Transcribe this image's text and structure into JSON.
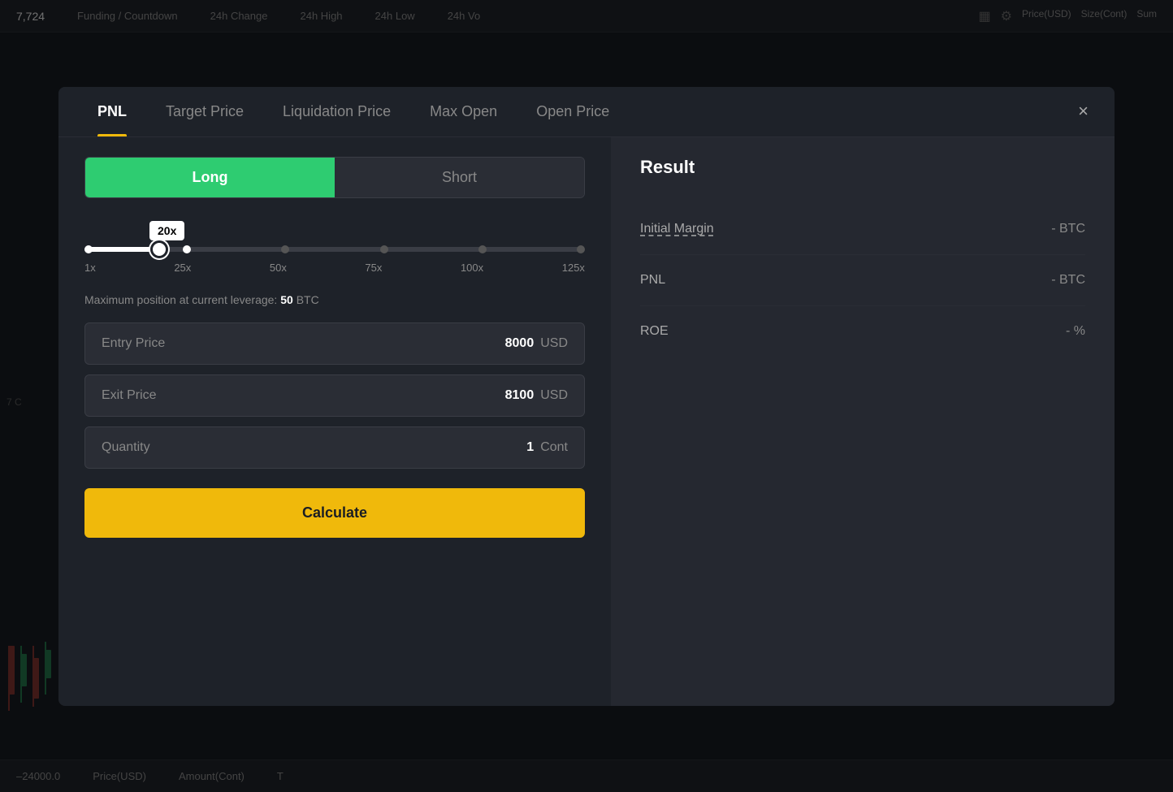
{
  "topBar": {
    "items": [
      "Funding / Countdown",
      "24h Change",
      "24h High",
      "24h Low",
      "24h Vo"
    ]
  },
  "bottomBar": {
    "items": [
      "–24000.0",
      "Price(USD)",
      "Amount(Cont)",
      "T"
    ]
  },
  "priceDisplay": "7,724",
  "modal": {
    "tabs": [
      {
        "id": "pnl",
        "label": "PNL",
        "active": true
      },
      {
        "id": "target-price",
        "label": "Target Price",
        "active": false
      },
      {
        "id": "liquidation-price",
        "label": "Liquidation Price",
        "active": false
      },
      {
        "id": "max-open",
        "label": "Max Open",
        "active": false
      },
      {
        "id": "open-price",
        "label": "Open Price",
        "active": false
      }
    ],
    "closeLabel": "×",
    "left": {
      "toggles": [
        {
          "id": "long",
          "label": "Long",
          "active": true
        },
        {
          "id": "short",
          "label": "Short",
          "active": false
        }
      ],
      "leverage": {
        "current": "20x",
        "labels": [
          "1x",
          "25x",
          "50x",
          "75x",
          "100x",
          "125x"
        ]
      },
      "maxPosition": {
        "prefix": "Maximum position at current leverage: ",
        "value": "50",
        "unit": "BTC"
      },
      "fields": [
        {
          "id": "entry-price",
          "label": "Entry Price",
          "value": "8000",
          "unit": "USD"
        },
        {
          "id": "exit-price",
          "label": "Exit Price",
          "value": "8100",
          "unit": "USD"
        },
        {
          "id": "quantity",
          "label": "Quantity",
          "value": "1",
          "unit": "Cont"
        }
      ],
      "calculateBtn": "Calculate"
    },
    "right": {
      "title": "Result",
      "rows": [
        {
          "id": "initial-margin",
          "label": "Initial Margin",
          "value": "- BTC",
          "underline": true
        },
        {
          "id": "pnl",
          "label": "PNL",
          "value": "- BTC",
          "underline": false
        },
        {
          "id": "roe",
          "label": "ROE",
          "value": "- %",
          "underline": false
        }
      ]
    }
  }
}
